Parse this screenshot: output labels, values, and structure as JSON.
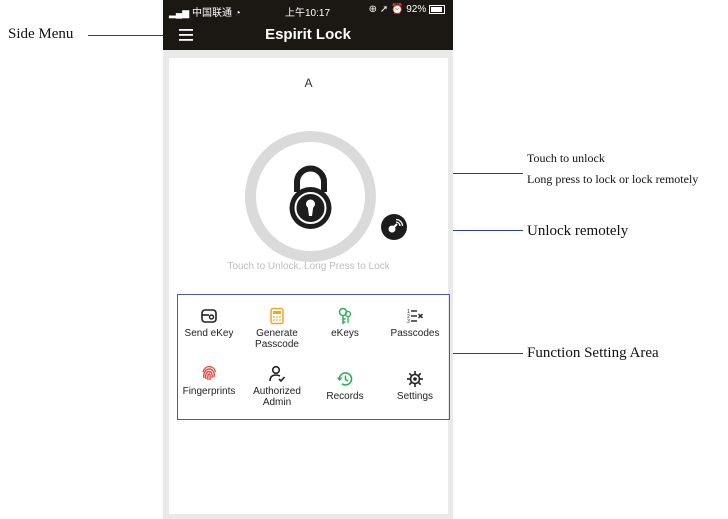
{
  "annotations": {
    "side_menu": "Side Menu",
    "touch_unlock": "Touch to unlock",
    "long_press": "Long press to lock or lock remotely",
    "unlock_remotely": "Unlock remotely",
    "function_area": "Function Setting Area"
  },
  "status_bar": {
    "carrier": "中国联通",
    "time": "上午10:17",
    "battery": "92%"
  },
  "header": {
    "title": "Espirit Lock"
  },
  "lock": {
    "name": "A",
    "hint": "Touch to Unlock, Long Press to Lock"
  },
  "functions": [
    {
      "label": "Send eKey",
      "icon": "send-ekey-icon"
    },
    {
      "label": "Generate Passcode",
      "icon": "calculator-icon"
    },
    {
      "label": "eKeys",
      "icon": "keys-icon"
    },
    {
      "label": "Passcodes",
      "icon": "list-icon"
    },
    {
      "label": "Fingerprints",
      "icon": "fingerprint-icon"
    },
    {
      "label": "Authorized Admin",
      "icon": "user-check-icon"
    },
    {
      "label": "Records",
      "icon": "history-icon"
    },
    {
      "label": "Settings",
      "icon": "gear-icon"
    }
  ],
  "colors": {
    "header_bg": "#1b1713",
    "annotation_line": "#2b3f8f",
    "function_border": "#4a5aa6",
    "generate_icon": "#f0a722",
    "ekeys_icon": "#2fae5a",
    "fingerprint_icon": "#e4493a",
    "records_icon": "#2fae5a"
  }
}
